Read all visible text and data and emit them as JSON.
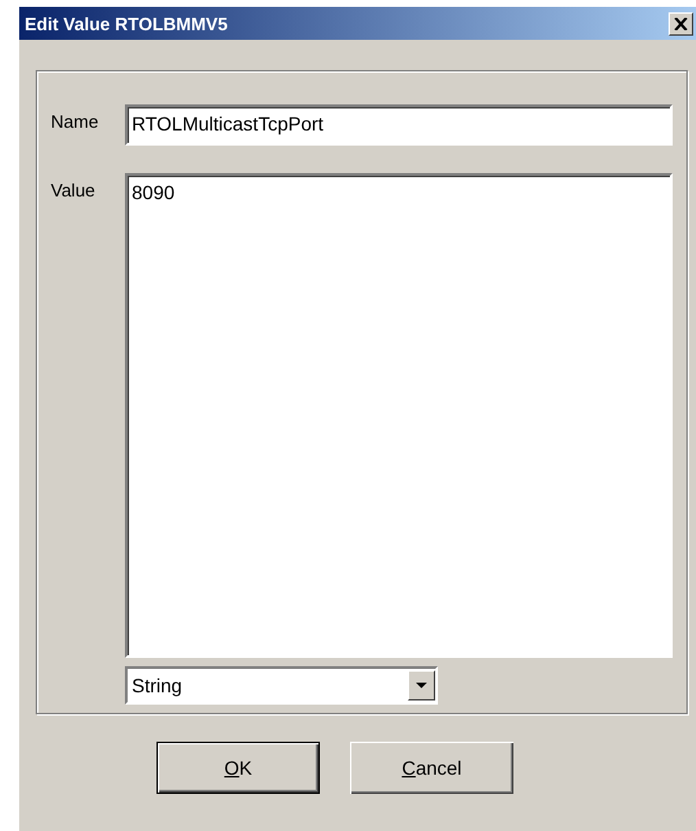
{
  "window": {
    "title": "Edit Value RTOLBMMV5"
  },
  "name_field": {
    "label": "Name",
    "value": "RTOLMulticastTcpPort"
  },
  "value_field": {
    "label": "Value",
    "value": "8090"
  },
  "type_select": {
    "value": "String"
  },
  "buttons": [
    {
      "accel": "O",
      "rest": "K",
      "default": true
    },
    {
      "accel": "C",
      "rest": "ancel",
      "default": false
    }
  ]
}
